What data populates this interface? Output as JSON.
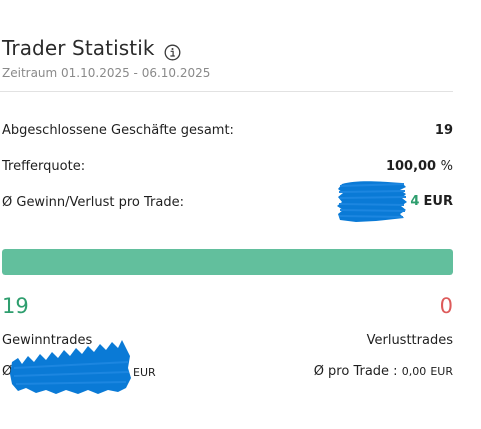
{
  "header": {
    "title": "Trader Statistik",
    "period": "Zeitraum 01.10.2025 - 06.10.2025",
    "info_icon": "info-circle-icon"
  },
  "stats": {
    "closed_trades_label": "Abgeschlossene Geschäfte gesamt:",
    "closed_trades_value": "19",
    "hit_rate_label": "Trefferquote:",
    "hit_rate_value": "100,00",
    "hit_rate_unit": "%",
    "avg_pl_label": "Ø Gewinn/Verlust pro Trade:",
    "avg_pl_visible_digit": "4",
    "avg_pl_unit": "EUR"
  },
  "progress": {
    "win_fraction": 1.0
  },
  "summary": {
    "win_count": "19",
    "loss_count": "0",
    "win_label": "Gewinntrades",
    "loss_label": "Verlusttrades",
    "win_avg_prefix": "Ø",
    "win_avg_unit": "EUR",
    "loss_avg_label": "Ø pro Trade :",
    "loss_avg_value": "0,00",
    "loss_avg_unit": "EUR"
  },
  "colors": {
    "win": "#2e9e6e",
    "loss": "#dd5a5a",
    "bar_fill": "#62bf9d",
    "redaction": "#0a7ad6"
  }
}
